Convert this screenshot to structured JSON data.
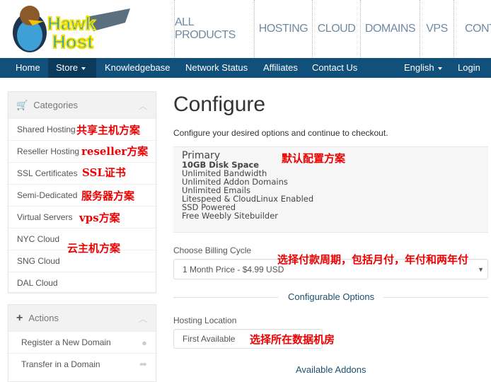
{
  "header": {
    "logo_text": "Hawk Host",
    "top_nav": [
      "ALL PRODUCTS",
      "HOSTING",
      "CLOUD",
      "DOMAINS",
      "VPS",
      "CONTA"
    ]
  },
  "navbar": {
    "items": [
      "Home",
      "Store",
      "Knowledgebase",
      "Network Status",
      "Affiliates",
      "Contact Us"
    ],
    "language": "English",
    "login": "Login"
  },
  "sidebar": {
    "categories_title": "Categories",
    "categories": [
      "Shared Hosting",
      "Reseller Hosting",
      "SSL Certificates",
      "Semi-Dedicated",
      "Virtual Servers",
      "NYC Cloud",
      "SNG Cloud",
      "DAL Cloud"
    ],
    "actions_title": "Actions",
    "actions": [
      "Register a New Domain",
      "Transfer in a Domain"
    ]
  },
  "main": {
    "title": "Configure",
    "subtitle": "Configure your desired options and continue to checkout.",
    "product": {
      "name": "Primary",
      "features": [
        "10GB Disk Space",
        "Unlimited Bandwidth",
        "Unlimited Addon Domains",
        "Unlimited Emails",
        "Litespeed & CloudLinux Enabled",
        "SSD Powered",
        "Free Weebly Sitebuilder"
      ]
    },
    "billing_label": "Choose Billing Cycle",
    "billing_value": "1 Month Price - $4.99 USD",
    "configurable_options": "Configurable Options",
    "location_label": "Hosting Location",
    "location_value": "First Available",
    "addons_title": "Available Addons"
  },
  "annotations": {
    "shared": "共享主机方案",
    "reseller": "reseller方案",
    "ssl": "SSL证书",
    "semi": "服务器方案",
    "vps": "vps方案",
    "cloud": "云主机方案",
    "default": "默认配置方案",
    "billing": "选择付款周期，包括月付，年付和两年付",
    "location": "选择所在数据机房"
  }
}
